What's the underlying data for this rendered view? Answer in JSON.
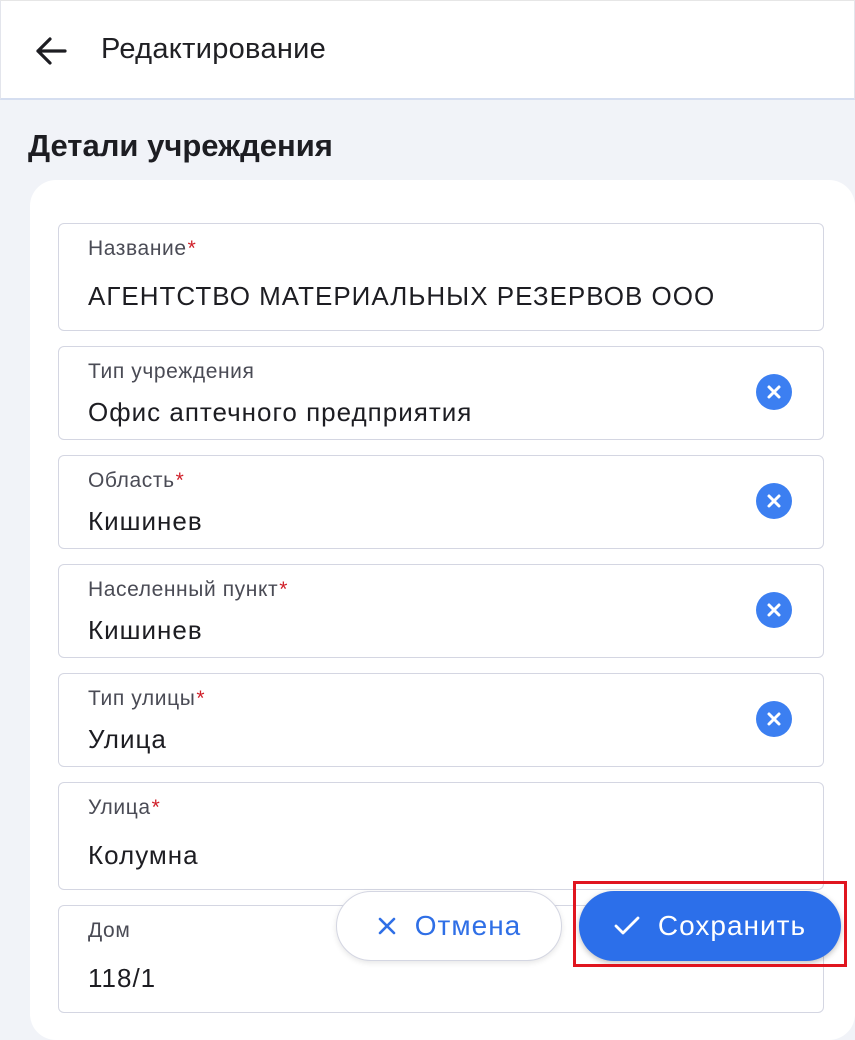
{
  "header": {
    "title": "Редактирование"
  },
  "section": {
    "title": "Детали учреждения"
  },
  "required_mark": "*",
  "fields": [
    {
      "label": "Название",
      "value": "АГЕНТСТВО МАТЕРИАЛЬНЫХ РЕЗЕРВОВ ООО"
    },
    {
      "label": "Тип учреждения",
      "value": "Офис аптечного предприятия"
    },
    {
      "label": "Область",
      "value": "Кишинев"
    },
    {
      "label": "Населенный пункт",
      "value": "Кишинев"
    },
    {
      "label": "Тип улицы",
      "value": "Улица"
    },
    {
      "label": "Улица",
      "value": "Колумна"
    },
    {
      "label": "Дом",
      "value": "118/1"
    }
  ],
  "actions": {
    "cancel_label": "Отмена",
    "save_label": "Сохранить"
  },
  "icons": {
    "back": "arrow-left-icon",
    "clear": "close-circle-icon",
    "cancel": "close-icon",
    "save": "check-icon"
  },
  "colors": {
    "accent": "#2c6fea",
    "required": "#d0202a",
    "highlight_box": "#e0151f",
    "background": "#f1f3f8"
  }
}
